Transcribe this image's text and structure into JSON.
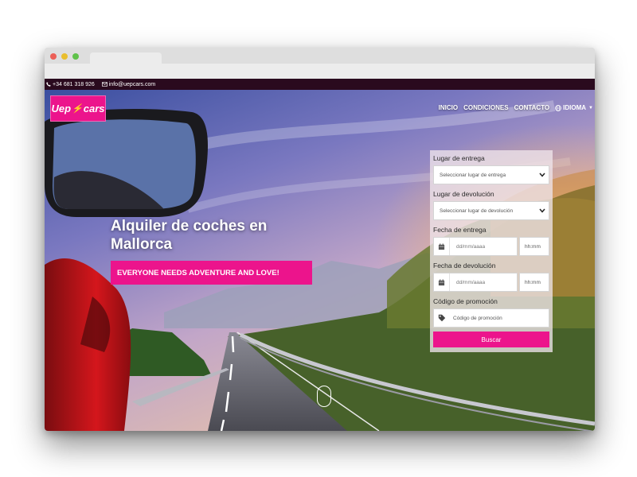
{
  "topbar": {
    "phone": "+34 681 318 926",
    "email": "info@uepcars.com"
  },
  "logo": {
    "text_left": "Uep",
    "text_right": "cars",
    "bolt": "⚡"
  },
  "nav": {
    "items": [
      "INICIO",
      "CONDICIONES",
      "CONTACTO"
    ],
    "language_label": "IDIOMA"
  },
  "hero": {
    "headline_line1": "Alquiler de coches en",
    "headline_line2": "Mallorca",
    "slogan": "EVERYONE NEEDS ADVENTURE AND LOVE!"
  },
  "form": {
    "pickup_label": "Lugar de entrega",
    "pickup_value": "Seleccionar lugar de entrega",
    "return_label": "Lugar de devolución",
    "return_value": "Seleccionar lugar de devolución",
    "pickup_date_label": "Fecha de entrega",
    "pickup_date_placeholder": "dd/mm/aaaa",
    "pickup_time_placeholder": "hh:mm",
    "return_date_label": "Fecha de devolución",
    "return_date_placeholder": "dd/mm/aaaa",
    "return_time_placeholder": "hh:mm",
    "promo_label": "Código de promoción",
    "promo_placeholder": "Código de promoción",
    "submit_label": "Buscar"
  },
  "colors": {
    "brand_pink": "#ec148c",
    "topbar_bg": "#2a0a1e",
    "bolt_yellow": "#ffd21a"
  },
  "icons": {
    "phone": "phone-icon",
    "email": "envelope-icon",
    "language": "globe-icon",
    "calendar": "calendar-icon",
    "promo": "tag-icon",
    "select": "chevron-down-icon",
    "scroll": "mouse-scroll-icon"
  }
}
